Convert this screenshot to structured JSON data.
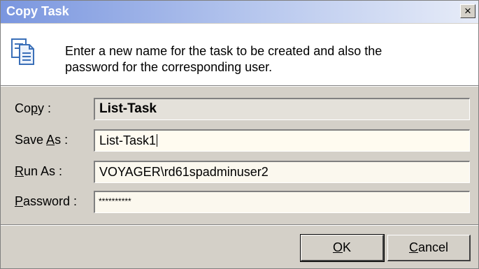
{
  "window": {
    "title": "Copy Task",
    "close_glyph": "×"
  },
  "banner": {
    "icon": "copy-document-icon",
    "line1": "Enter a new name for the task to be created and also the",
    "line2": "password for the corresponding user."
  },
  "form": {
    "copy": {
      "label_pre": "Co",
      "label_accel": "p",
      "label_post": "y :",
      "value": "List-Task"
    },
    "save_as": {
      "label_pre": "Save ",
      "label_accel": "A",
      "label_post": "s :",
      "value": "List-Task1"
    },
    "run_as": {
      "label_pre": "",
      "label_accel": "R",
      "label_post": "un As :",
      "value": "VOYAGER\\rd61spadminuser2"
    },
    "password": {
      "label_pre": "",
      "label_accel": "P",
      "label_post": "assword :",
      "value": "**********"
    }
  },
  "buttons": {
    "ok": {
      "accel": "O",
      "rest": "K"
    },
    "cancel": {
      "accel": "C",
      "rest": "ancel"
    }
  }
}
